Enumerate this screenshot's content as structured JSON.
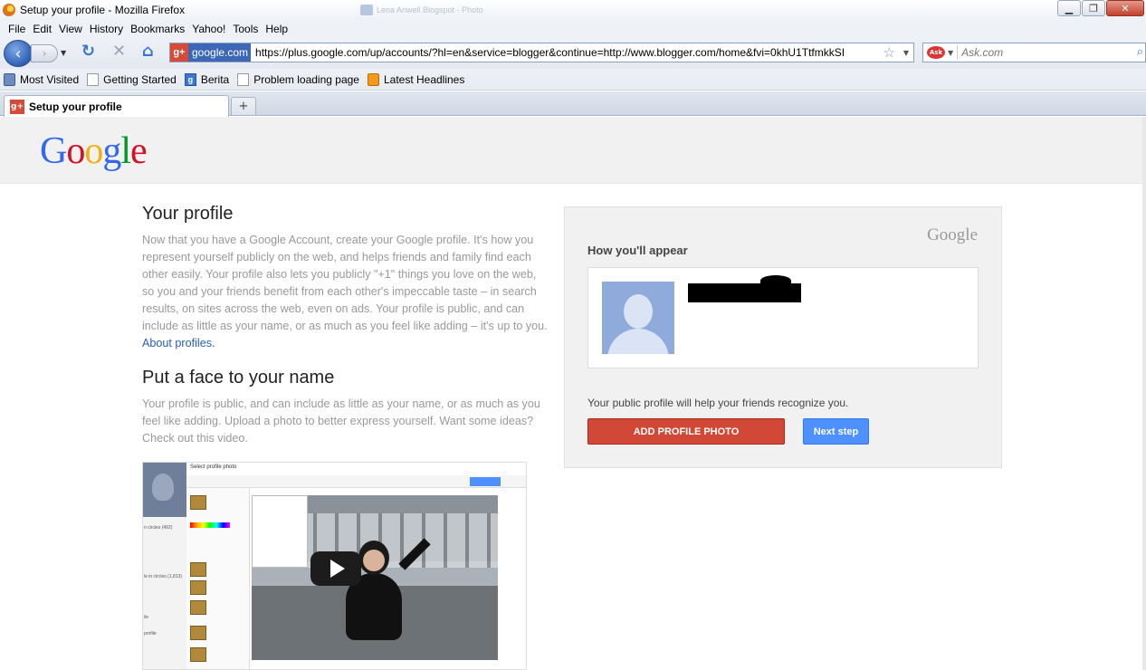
{
  "window": {
    "title": "Setup your profile - Mozilla Firefox",
    "background_tab": "Lena Anwell Blogspot - Photo",
    "buttons": {
      "minimize": "▁",
      "restore": "❐",
      "close": "✕"
    }
  },
  "menu": [
    "File",
    "Edit",
    "View",
    "History",
    "Bookmarks",
    "Yahoo!",
    "Tools",
    "Help"
  ],
  "navigation": {
    "site_identity": "google.com",
    "url": "https://plus.google.com/up/accounts/?hl=en&service=blogger&continue=http://www.blogger.com/home&fvi=0khU1TtfmkkSI",
    "search_placeholder": "Ask.com",
    "search_engine_icon": "ask-logo"
  },
  "bookmarks": [
    "Most Visited",
    "Getting Started",
    "Berita",
    "Problem loading page",
    "Latest Headlines"
  ],
  "tabs": [
    {
      "label": "Setup your profile",
      "active": true
    }
  ],
  "page": {
    "logo": [
      "G",
      "o",
      "o",
      "g",
      "l",
      "e"
    ],
    "your_profile": {
      "heading": "Your profile",
      "body": "Now that you have a Google Account, create your Google profile. It's how you represent yourself publicly on the web, and helps friends and family find each other easily. Your profile also lets you publicly \"+1\" things you love on the web, so you and your friends benefit from each other's impeccable taste – in search results, on sites across the web, even on ads. Your profile is public, and can include as little as your name, or as much as you feel like adding – it's up to you.",
      "link": "About profiles."
    },
    "face": {
      "heading": "Put a face to your name",
      "body": "Your profile is public, and can include as little as your name, or as much as you feel like adding. Upload a photo to better express yourself. Want some ideas? Check out this video."
    },
    "video": {
      "dialog_title": "Select profile photo",
      "sidebar_texts": [
        "n circles (492)",
        "le in circles (1,813)",
        "ile",
        "profile"
      ]
    },
    "card": {
      "brand": "Google",
      "title": "How you'll appear",
      "description": "Your public profile will help your friends recognize you.",
      "add_photo_button": "ADD PROFILE PHOTO",
      "next_button": "Next step"
    }
  },
  "colors": {
    "add_photo": "#d14836",
    "next_step": "#4d90fe",
    "link": "#2a5db0"
  }
}
